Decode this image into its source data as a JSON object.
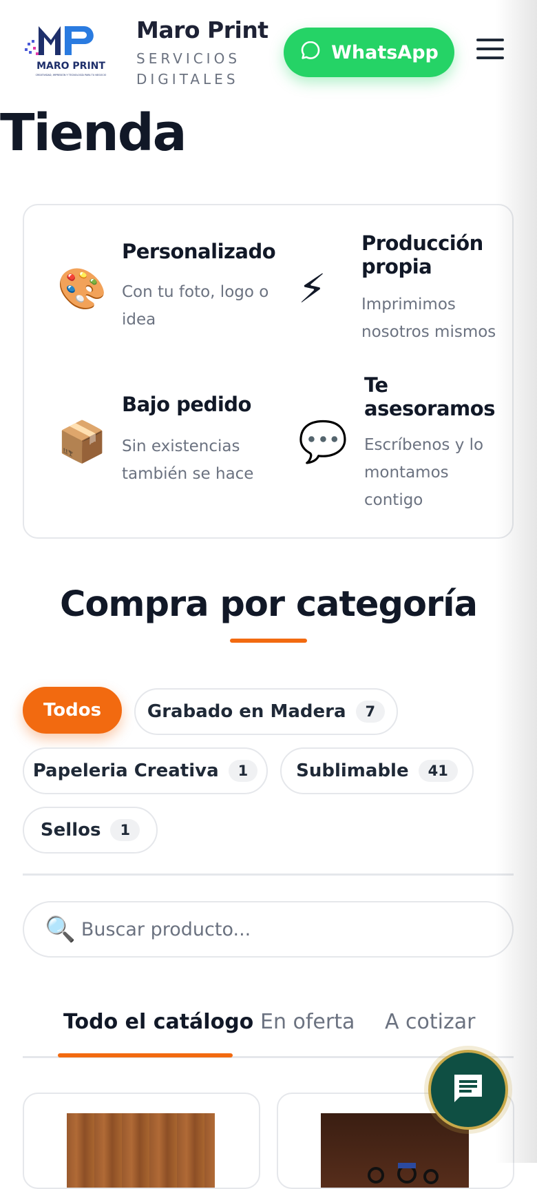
{
  "header": {
    "logo_alt": "Maro Print logo",
    "logo_text": "MARO PRINT",
    "logo_tagline": "CREATIVIDAD, IMPRESIÓN Y TECNOLOGÍA PARA TU NEGOCIO",
    "brand_name": "Maro Print",
    "brand_sub": "SERVICIOS DIGITALES",
    "whatsapp_label": "WhatsApp",
    "menu_icon": "hamburger-menu-icon"
  },
  "page": {
    "title": "Tienda"
  },
  "features": [
    {
      "icon": "🎨",
      "icon_name": "palette-icon",
      "title": "Personalizado",
      "text": "Con tu foto, logo o idea"
    },
    {
      "icon": "⚡",
      "icon_name": "lightning-icon",
      "title": "Producción propia",
      "text": "Imprimimos nosotros mismos"
    },
    {
      "icon": "📦",
      "icon_name": "package-icon",
      "title": "Bajo pedido",
      "text": "Sin existencias también se hace"
    },
    {
      "icon": "💬",
      "icon_name": "speech-bubble-icon",
      "title": "Te asesoramos",
      "text": "Escríbenos y lo montamos contigo"
    }
  ],
  "categories": {
    "heading": "Compra por categoría",
    "chips": [
      {
        "label": "Todos",
        "count": null,
        "active": true
      },
      {
        "label": "Grabado en Madera",
        "count": "7",
        "active": false
      },
      {
        "label": "Papeleria Creativa",
        "count": "1",
        "active": false
      },
      {
        "label": "Sublimable",
        "count": "41",
        "active": false
      },
      {
        "label": "Sellos",
        "count": "1",
        "active": false
      }
    ]
  },
  "search": {
    "placeholder": "Buscar producto...",
    "value": ""
  },
  "tabs": [
    {
      "label": "Todo el catálogo",
      "active": true
    },
    {
      "label": "En oferta",
      "active": false
    },
    {
      "label": "A cotizar",
      "active": false
    }
  ],
  "colors": {
    "accent": "#f26a10",
    "whatsapp": "#25d366",
    "chat_fab": "#0f4f43",
    "text_dark": "#111827",
    "text_muted": "#6b7280"
  },
  "chat_fab": {
    "icon": "chat-icon"
  }
}
